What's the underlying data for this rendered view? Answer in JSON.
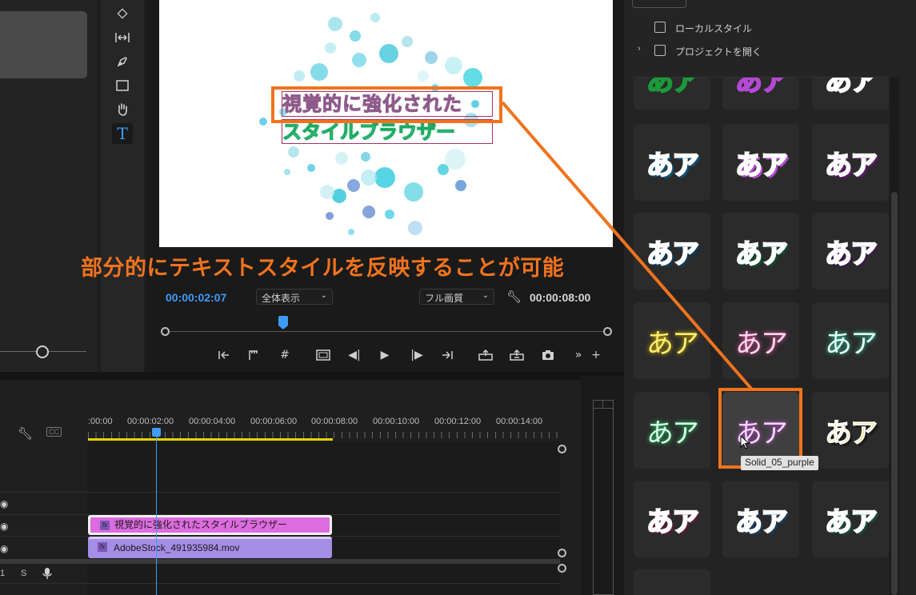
{
  "monitor": {
    "video_title_line1": "視覚的に強化された",
    "video_title_line2": "スタイルブラウザー",
    "current_timecode": "00:00:02:07",
    "end_timecode": "00:00:08:00",
    "zoom_select": "全体表示",
    "quality_select": "フル画質"
  },
  "annotation": "部分的にテキストスタイルを反映することが可能",
  "timeline": {
    "ruler_labels": [
      ":00:00",
      "00:00:02:00",
      "00:00:04:00",
      "00:00:06:00",
      "00:00:08:00",
      "00:00:10:00",
      "00:00:12:00",
      "00:00:14:00"
    ],
    "clip_title": "視覚的に強化されたスタイルブラウザー",
    "clip_video": "AdobeStock_491935984.mov",
    "track_s": "S",
    "track_num": "1",
    "cc": "CC"
  },
  "style_browser": {
    "local_styles": "ローカルスタイル",
    "open_project": "プロジェクトを開く",
    "tile_text": "あア",
    "tooltip": "Solid_05_purple",
    "accent": "#f0731e"
  },
  "icons": {
    "toolbar": [
      "ripple-edit-icon",
      "slip-icon",
      "pen-icon",
      "rectangle-icon",
      "hand-icon",
      "type-icon"
    ]
  }
}
